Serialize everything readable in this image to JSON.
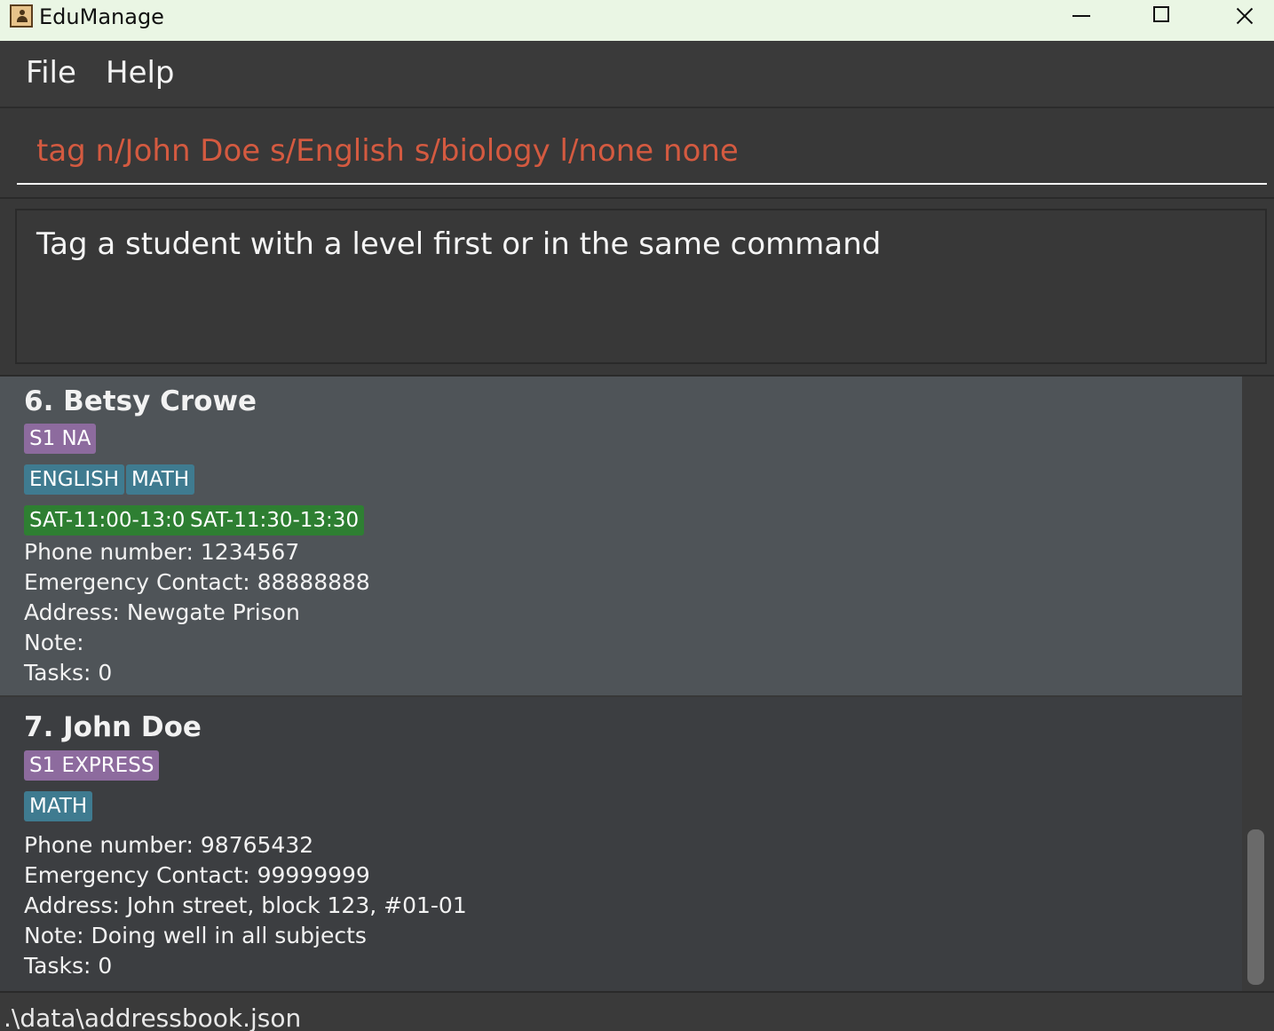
{
  "window": {
    "title": "EduManage"
  },
  "menu": {
    "file": "File",
    "help": "Help"
  },
  "command": {
    "value": "tag n/John Doe s/English s/biology l/none none"
  },
  "result": {
    "message": "Tag a student with a level first or in the same command"
  },
  "students": [
    {
      "name": "6. Betsy Crowe",
      "level": "S1 NA",
      "subjects": [
        "ENGLISH",
        "MATH"
      ],
      "lessons": [
        "SAT-11:00-13:00",
        "SAT-11:30-13:30"
      ],
      "phone": "Phone number: 1234567",
      "emergency": "Emergency Contact: 88888888",
      "address": "Address: Newgate Prison",
      "note": "Note:",
      "tasks": "Tasks: 0"
    },
    {
      "name": "7. John Doe",
      "level": "S1 EXPRESS",
      "subjects": [
        "MATH"
      ],
      "lessons": [],
      "phone": "Phone number: 98765432",
      "emergency": "Emergency Contact: 99999999",
      "address": "Address: John street, block 123, #01-01",
      "note": "Note: Doing well in all subjects",
      "tasks": "Tasks: 0"
    }
  ],
  "status": {
    "path": ".\\data\\addressbook.json"
  },
  "colors": {
    "command_text": "#d45a40",
    "level_tag": "#8d6b9e",
    "subject_tag": "#3f7b90",
    "lesson_tag": "#2e7f32",
    "selected_card": "#4f5458",
    "card": "#3c3e41"
  }
}
